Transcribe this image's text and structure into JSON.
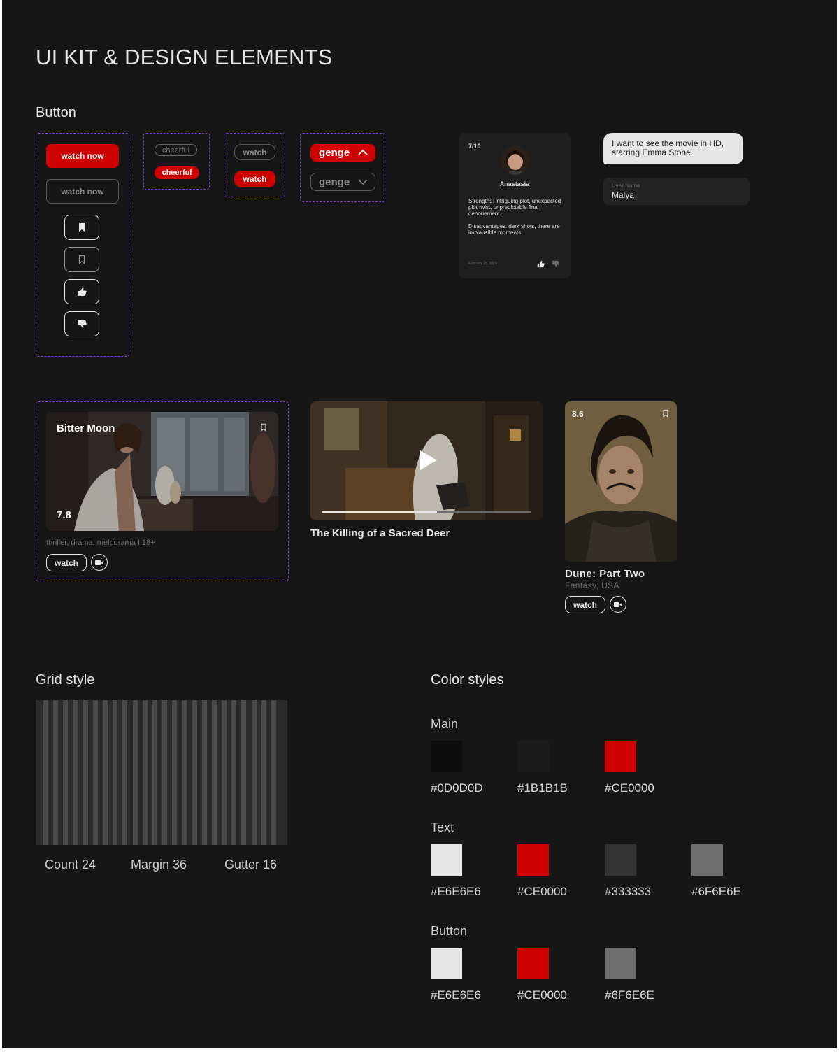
{
  "page_title": "UI KIT & DESIGN ELEMENTS",
  "sections": {
    "button": "Button",
    "grid": "Grid style",
    "colors": "Color styles"
  },
  "buttons": {
    "watch_now_primary": "watch now",
    "watch_now_outline": "watch now",
    "cheerful_outline": "cheerful",
    "cheerful_filled": "cheerful",
    "watch_outline": "watch",
    "watch_filled": "watch",
    "genre_open": "genge",
    "genre_closed": "genge",
    "icons": [
      "bookmark-filled-icon",
      "bookmark-outline-icon",
      "thumbs-up-icon",
      "thumbs-down-icon"
    ]
  },
  "review_card": {
    "score": "7/10",
    "name": "Anastasia",
    "strengths": "Strengths: intriguing plot, unexpected plot twist, unpredictable final denouement.",
    "disadvantages": "Disadvantages: dark shots, there are implausible moments.",
    "date": "February 26, 2024"
  },
  "chat": {
    "message": "I want to see the movie in HD, starring Emma Stone."
  },
  "user_field": {
    "label": "User Name",
    "value": "Malya"
  },
  "movies": {
    "bitter_moon": {
      "title": "Bitter Moon",
      "rating": "7.8",
      "genres": "thriller, drama, melodrama I 18+",
      "watch": "watch"
    },
    "sacred_deer": {
      "title": "The Killing of a Sacred Deer",
      "progress": 0.55
    },
    "dune": {
      "rating": "8.6",
      "title": "Dune: Part Two",
      "meta": "Fantasy, USA",
      "watch": "watch"
    }
  },
  "grid": {
    "count_label": "Count 24",
    "margin_label": "Margin 36",
    "gutter_label": "Gutter 16"
  },
  "colors": {
    "main_label": "Main",
    "main": [
      "#0D0D0D",
      "#1B1B1B",
      "#CE0000"
    ],
    "text_label": "Text",
    "text": [
      "#E6E6E6",
      "#CE0000",
      "#333333",
      "#6F6E6E"
    ],
    "button_label": "Button",
    "button": [
      "#E6E6E6",
      "#CE0000",
      "#6F6E6E"
    ]
  }
}
